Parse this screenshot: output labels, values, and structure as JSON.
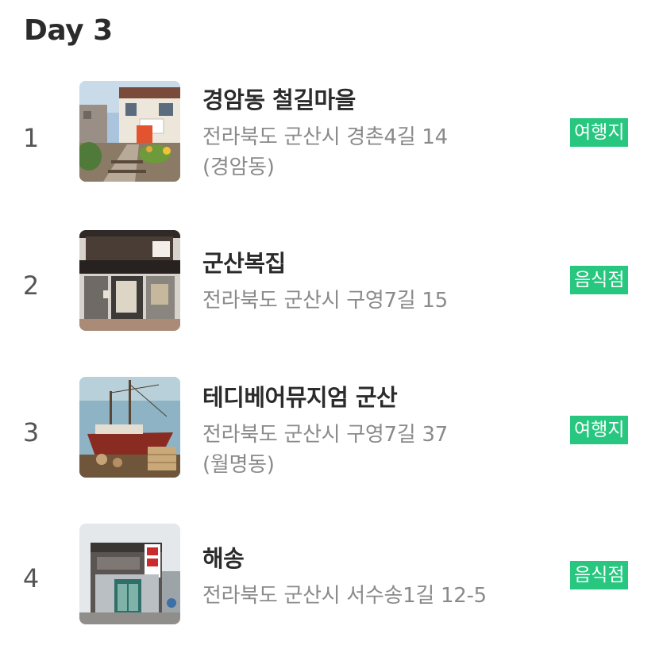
{
  "day": {
    "title": "Day 3"
  },
  "items": [
    {
      "number": "1",
      "name": "경암동 철길마을",
      "address_line1": "전라북도 군산시 경촌4길 14",
      "address_line2": "(경암동)",
      "category": "여행지"
    },
    {
      "number": "2",
      "name": "군산복집",
      "address_line1": "전라북도 군산시 구영7길 15",
      "address_line2": "",
      "category": "음식점"
    },
    {
      "number": "3",
      "name": "테디베어뮤지엄 군산",
      "address_line1": "전라북도 군산시 구영7길 37",
      "address_line2": "(월명동)",
      "category": "여행지"
    },
    {
      "number": "4",
      "name": "해송",
      "address_line1": "전라북도 군산시 서수송1길 12-5",
      "address_line2": "",
      "category": "음식점"
    }
  ],
  "colors": {
    "badge_bg": "#27c77f",
    "title_text": "#2b2b2b",
    "address_text": "#8a8a8a"
  }
}
